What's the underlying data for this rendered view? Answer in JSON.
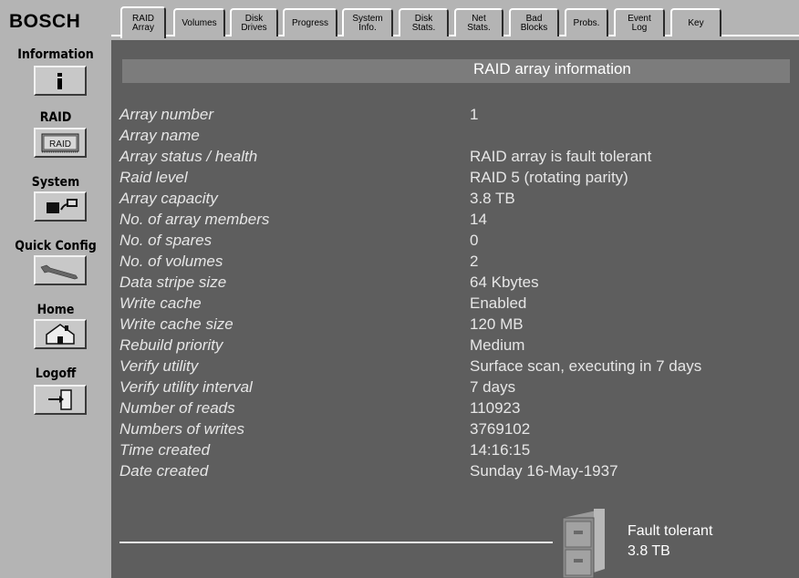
{
  "brand": "BOSCH",
  "sidebar": {
    "items": [
      {
        "label": "Information",
        "icon": "info-icon"
      },
      {
        "label": "RAID",
        "icon": "raid-icon",
        "icon_text": "RAID"
      },
      {
        "label": "System",
        "icon": "computer-icon"
      },
      {
        "label": "Quick Config",
        "icon": "wrench-icon"
      },
      {
        "label": "Home",
        "icon": "house-icon"
      },
      {
        "label": "Logoff",
        "icon": "door-exit-icon"
      }
    ]
  },
  "tabs": [
    {
      "label": "RAID\nArray",
      "active": true
    },
    {
      "label": "Volumes",
      "active": false
    },
    {
      "label": "Disk\nDrives",
      "active": false
    },
    {
      "label": "Progress",
      "active": false
    },
    {
      "label": "System\nInfo.",
      "active": false
    },
    {
      "label": "Disk\nStats.",
      "active": false
    },
    {
      "label": "Net\nStats.",
      "active": false
    },
    {
      "label": "Bad\nBlocks",
      "active": false
    },
    {
      "label": "Probs.",
      "active": false
    },
    {
      "label": "Event\nLog",
      "active": false
    },
    {
      "label": "Key",
      "active": false
    }
  ],
  "page": {
    "title": "RAID array information",
    "rows": [
      {
        "label": "Array number",
        "value": "1"
      },
      {
        "label": "Array name",
        "value": ""
      },
      {
        "label": "Array status / health",
        "value": "RAID array is fault tolerant"
      },
      {
        "label": "Raid level",
        "value": "RAID 5 (rotating parity)"
      },
      {
        "label": "Array capacity",
        "value": "3.8 TB"
      },
      {
        "label": "No. of array members",
        "value": "14"
      },
      {
        "label": "No. of spares",
        "value": "0"
      },
      {
        "label": "No. of volumes",
        "value": "2"
      },
      {
        "label": "Data stripe size",
        "value": "64 Kbytes"
      },
      {
        "label": "Write cache",
        "value": "Enabled"
      },
      {
        "label": "Write cache size",
        "value": "120 MB"
      },
      {
        "label": "Rebuild priority",
        "value": "Medium"
      },
      {
        "label": "Verify utility",
        "value": "Surface scan, executing in 7 days"
      },
      {
        "label": "Verify utility interval",
        "value": "7 days"
      },
      {
        "label": "Number of reads",
        "value": "110923"
      },
      {
        "label": "Numbers of writes",
        "value": "3769102"
      },
      {
        "label": "Time created",
        "value": "14:16:15"
      },
      {
        "label": "Date created",
        "value": "Sunday 16-May-1937"
      }
    ],
    "status": {
      "icon": "file-cabinet-icon",
      "line1": "Fault tolerant",
      "line2": "3.8 TB"
    }
  },
  "colors": {
    "sidebar_bg": "#b4b4b4",
    "content_bg": "#5e5e5e",
    "header_bar": "#7c7c7c",
    "text": "#e6e6e6"
  }
}
